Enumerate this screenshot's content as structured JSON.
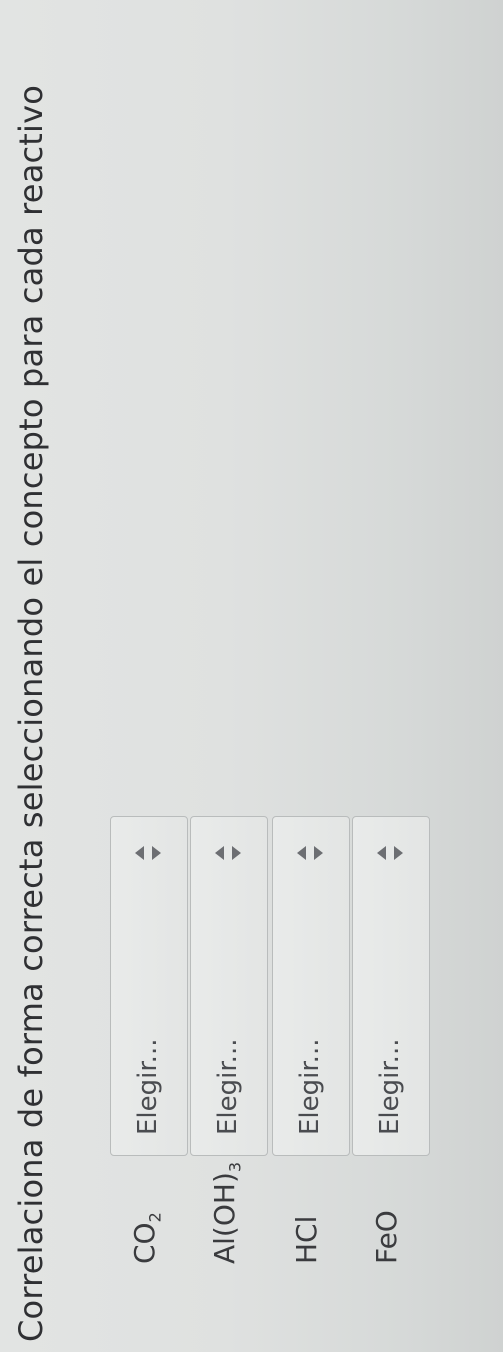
{
  "instruction": "Correlaciona de forma correcta seleccionando el concepto para cada reactivo",
  "rows": [
    {
      "formula": "CO",
      "sub": "2",
      "suffix": "",
      "select_value": "Elegir..."
    },
    {
      "formula": "Al(OH)",
      "sub": "3",
      "suffix": "",
      "select_value": "Elegir..."
    },
    {
      "formula": "HCl",
      "sub": "",
      "suffix": "",
      "select_value": "Elegir..."
    },
    {
      "formula": "FeO",
      "sub": "",
      "suffix": "",
      "select_value": "Elegir..."
    }
  ],
  "icons": {
    "select_caret": "up-down-caret-icon"
  }
}
